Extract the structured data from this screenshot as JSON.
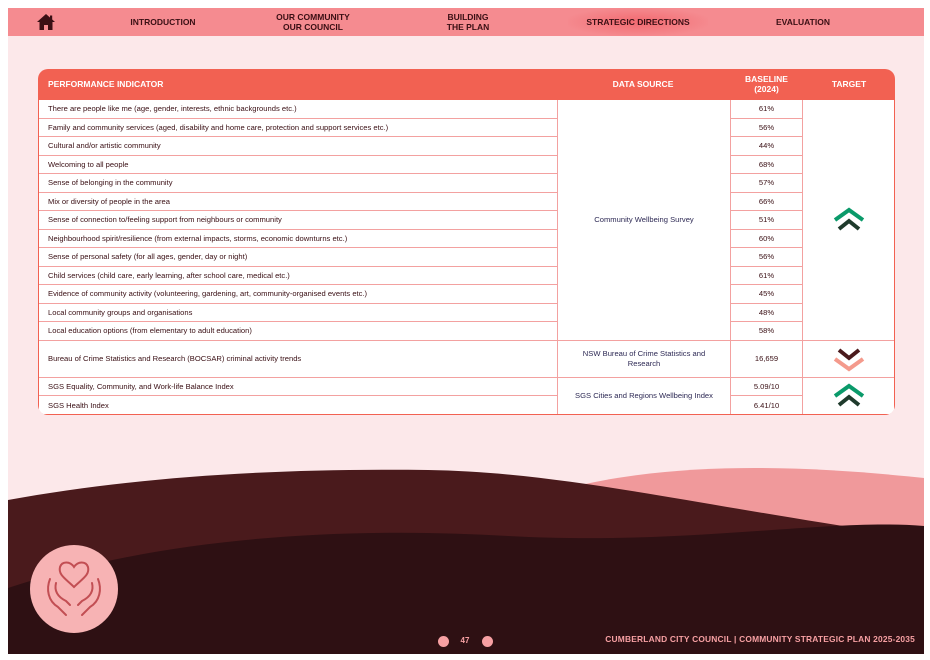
{
  "nav": {
    "items": [
      {
        "label": "INTRODUCTION"
      },
      {
        "label": "OUR COMMUNITY\nOUR COUNCIL"
      },
      {
        "label": "BUILDING\nTHE PLAN"
      },
      {
        "label": "STRATEGIC DIRECTIONS"
      },
      {
        "label": "EVALUATION"
      }
    ]
  },
  "table": {
    "headers": {
      "indicator": "PERFORMANCE INDICATOR",
      "source": "DATA SOURCE",
      "baseline_line1": "BASELINE",
      "baseline_line2": "(2024)",
      "target": "TARGET"
    },
    "rows": [
      {
        "indicator": "There are people like me (age, gender, interests, ethnic backgrounds etc.)",
        "baseline": "61%"
      },
      {
        "indicator": "Family and community services (aged, disability and home care, protection and support services etc.)",
        "baseline": "56%"
      },
      {
        "indicator": "Cultural and/or artistic community",
        "baseline": "44%"
      },
      {
        "indicator": "Welcoming to all people",
        "baseline": "68%"
      },
      {
        "indicator": "Sense of belonging in the community",
        "baseline": "57%"
      },
      {
        "indicator": "Mix or diversity of people in the area",
        "baseline": "66%"
      },
      {
        "indicator": "Sense of connection to/feeling support from neighbours or community",
        "baseline": "51%"
      },
      {
        "indicator": "Neighbourhood spirit/resilience (from external impacts, storms, economic downturns etc.)",
        "baseline": "60%"
      },
      {
        "indicator": "Sense of personal safety (for all ages, gender, day or night)",
        "baseline": "56%"
      },
      {
        "indicator": "Child services (child care, early learning, after school care, medical etc.)",
        "baseline": "61%"
      },
      {
        "indicator": "Evidence of community activity (volunteering, gardening, art, community-organised events etc.)",
        "baseline": "45%"
      },
      {
        "indicator": "Local community groups and organisations",
        "baseline": "48%"
      },
      {
        "indicator": "Local education options (from elementary to adult education)",
        "baseline": "58%"
      },
      {
        "indicator": "Bureau of Crime Statistics and Research (BOCSAR) criminal activity trends",
        "baseline": "16,659"
      },
      {
        "indicator": "SGS Equality, Community, and Work-life Balance Index",
        "baseline": "5.09/10"
      },
      {
        "indicator": "SGS Health Index",
        "baseline": "6.41/10"
      }
    ],
    "sources": [
      {
        "label": "Community Wellbeing Survey"
      },
      {
        "label": "NSW Bureau of Crime Statistics and Research"
      },
      {
        "label": "SGS Cities and Regions Wellbeing Index"
      }
    ],
    "targets": [
      {
        "direction": "up",
        "icon": "double-chevron-up-icon"
      },
      {
        "direction": "down",
        "icon": "double-chevron-down-icon"
      },
      {
        "direction": "up",
        "icon": "double-chevron-up-icon"
      }
    ]
  },
  "colors": {
    "nav_bg": "#f58b90",
    "header_bg": "#f26152",
    "up_dark": "#1f3a2c",
    "up_green": "#0a9a6a",
    "down_dark": "#4a1a1c",
    "down_pink": "#f49a8c"
  },
  "footer": {
    "page_number": "47",
    "council": "CUMBERLAND CITY COUNCIL",
    "separator": "|",
    "plan": "COMMUNITY STRATEGIC PLAN 2025-2035"
  }
}
